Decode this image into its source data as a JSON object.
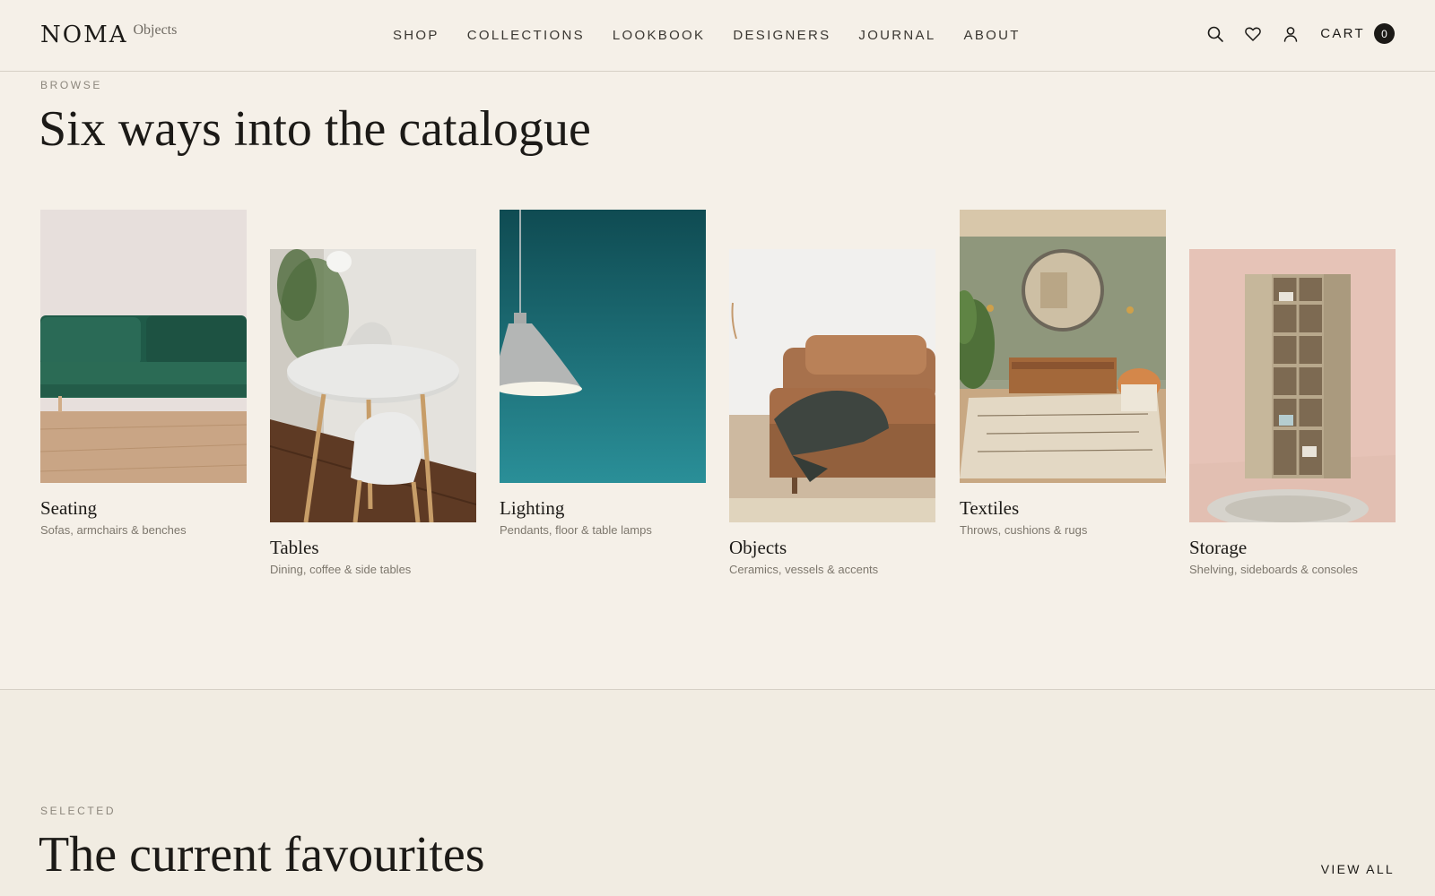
{
  "header": {
    "brand": "NOMA",
    "brand_sub": "Objects",
    "nav": [
      "SHOP",
      "COLLECTIONS",
      "LOOKBOOK",
      "DESIGNERS",
      "JOURNAL",
      "ABOUT"
    ],
    "icons": [
      "search-icon",
      "heart-icon",
      "user-icon"
    ],
    "cart_label": "CART",
    "cart_count": "0"
  },
  "browse": {
    "eyebrow": "BROWSE",
    "title": "Six ways into the catalogue",
    "categories": [
      {
        "title": "Seating",
        "subtitle": "Sofas, armchairs & benches"
      },
      {
        "title": "Tables",
        "subtitle": "Dining, coffee & side tables"
      },
      {
        "title": "Lighting",
        "subtitle": "Pendants, floor & table lamps"
      },
      {
        "title": "Objects",
        "subtitle": "Ceramics, vessels & accents"
      },
      {
        "title": "Textiles",
        "subtitle": "Throws, cushions & rugs"
      },
      {
        "title": "Storage",
        "subtitle": "Shelving, sideboards & consoles"
      }
    ]
  },
  "selected": {
    "eyebrow": "SELECTED",
    "title": "The current favourites",
    "view_all": "VIEW ALL"
  },
  "colors": {
    "background": "#f5f0e8",
    "text": "#1c1a17",
    "muted": "#7d776d"
  }
}
